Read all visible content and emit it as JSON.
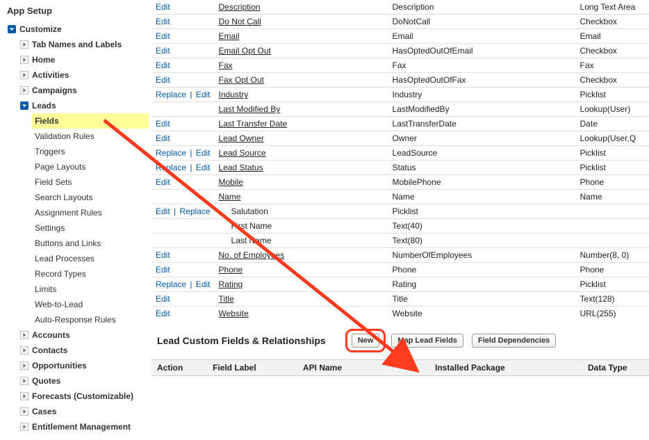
{
  "sidebar": {
    "title": "App Setup",
    "nodes": [
      {
        "label": "Customize",
        "expanded": true,
        "children": [
          {
            "label": "Tab Names and Labels",
            "expanded": false,
            "leaf": false
          },
          {
            "label": "Home",
            "expanded": false,
            "leaf": false
          },
          {
            "label": "Activities",
            "expanded": false,
            "leaf": false
          },
          {
            "label": "Campaigns",
            "expanded": false,
            "leaf": false
          },
          {
            "label": "Leads",
            "expanded": true,
            "children": [
              {
                "label": "Fields",
                "leaf": true,
                "highlighted": true
              },
              {
                "label": "Validation Rules",
                "leaf": true
              },
              {
                "label": "Triggers",
                "leaf": true
              },
              {
                "label": "Page Layouts",
                "leaf": true
              },
              {
                "label": "Field Sets",
                "leaf": true
              },
              {
                "label": "Search Layouts",
                "leaf": true
              },
              {
                "label": "Assignment Rules",
                "leaf": true
              },
              {
                "label": "Settings",
                "leaf": true
              },
              {
                "label": "Buttons and Links",
                "leaf": true
              },
              {
                "label": "Lead Processes",
                "leaf": true
              },
              {
                "label": "Record Types",
                "leaf": true
              },
              {
                "label": "Limits",
                "leaf": true
              },
              {
                "label": "Web-to-Lead",
                "leaf": true
              },
              {
                "label": "Auto-Response Rules",
                "leaf": true
              }
            ]
          },
          {
            "label": "Accounts",
            "expanded": false,
            "leaf": false
          },
          {
            "label": "Contacts",
            "expanded": false,
            "leaf": false
          },
          {
            "label": "Opportunities",
            "expanded": false,
            "leaf": false
          },
          {
            "label": "Quotes",
            "expanded": false,
            "leaf": false
          },
          {
            "label": "Forecasts (Customizable)",
            "expanded": false,
            "leaf": false
          },
          {
            "label": "Cases",
            "expanded": false,
            "leaf": false
          },
          {
            "label": "Entitlement Management",
            "expanded": false,
            "leaf": false
          }
        ]
      }
    ]
  },
  "fields": [
    {
      "actions": [
        "Edit"
      ],
      "label": "Description",
      "api": "Description",
      "type": "Long Text Area",
      "underline": true
    },
    {
      "actions": [
        "Edit"
      ],
      "label": "Do Not Call",
      "api": "DoNotCall",
      "type": "Checkbox",
      "underline": true
    },
    {
      "actions": [
        "Edit"
      ],
      "label": "Email",
      "api": "Email",
      "type": "Email",
      "underline": true
    },
    {
      "actions": [
        "Edit"
      ],
      "label": "Email Opt Out",
      "api": "HasOptedOutOfEmail",
      "type": "Checkbox",
      "underline": true
    },
    {
      "actions": [
        "Edit"
      ],
      "label": "Fax",
      "api": "Fax",
      "type": "Fax",
      "underline": true
    },
    {
      "actions": [
        "Edit"
      ],
      "label": "Fax Opt Out",
      "api": "HasOptedOutOfFax",
      "type": "Checkbox",
      "underline": true
    },
    {
      "actions": [
        "Replace",
        "Edit"
      ],
      "label": "Industry",
      "api": "Industry",
      "type": "Picklist",
      "underline": true
    },
    {
      "actions": [],
      "label": "Last Modified By",
      "api": "LastModifiedBy",
      "type": "Lookup(User)",
      "underline": true
    },
    {
      "actions": [
        "Edit"
      ],
      "label": "Last Transfer Date",
      "api": "LastTransferDate",
      "type": "Date",
      "underline": true
    },
    {
      "actions": [
        "Edit"
      ],
      "label": "Lead Owner",
      "api": "Owner",
      "type": "Lookup(User,Q",
      "underline": true
    },
    {
      "actions": [
        "Replace",
        "Edit"
      ],
      "label": "Lead Source",
      "api": "LeadSource",
      "type": "Picklist",
      "underline": true
    },
    {
      "actions": [
        "Replace",
        "Edit"
      ],
      "label": "Lead Status",
      "api": "Status",
      "type": "Picklist",
      "underline": true
    },
    {
      "actions": [
        "Edit"
      ],
      "label": "Mobile",
      "api": "MobilePhone",
      "type": "Phone",
      "underline": true
    },
    {
      "actions": [],
      "label": "Name",
      "api": "Name",
      "type": "Name",
      "underline": true
    },
    {
      "actions": [
        "Edit",
        "Replace"
      ],
      "label": "Salutation",
      "api": "Picklist",
      "type": "",
      "indent": true,
      "underline": false
    },
    {
      "actions": [],
      "label": "First Name",
      "api": "Text(40)",
      "type": "",
      "indent": true,
      "underline": false
    },
    {
      "actions": [],
      "label": "Last Name",
      "api": "Text(80)",
      "type": "",
      "indent": true,
      "underline": false
    },
    {
      "actions": [
        "Edit"
      ],
      "label": "No. of Employees",
      "api": "NumberOfEmployees",
      "type": "Number(8, 0)",
      "underline": true
    },
    {
      "actions": [
        "Edit"
      ],
      "label": "Phone",
      "api": "Phone",
      "type": "Phone",
      "underline": true
    },
    {
      "actions": [
        "Replace",
        "Edit"
      ],
      "label": "Rating",
      "api": "Rating",
      "type": "Picklist",
      "underline": true
    },
    {
      "actions": [
        "Edit"
      ],
      "label": "Title",
      "api": "Title",
      "type": "Text(128)",
      "underline": true
    },
    {
      "actions": [
        "Edit"
      ],
      "label": "Website",
      "api": "Website",
      "type": "URL(255)",
      "underline": true
    }
  ],
  "custom_section": {
    "title": "Lead Custom Fields & Relationships",
    "buttons": {
      "new": "New",
      "map": "Map Lead Fields",
      "deps": "Field Dependencies"
    },
    "columns": [
      "Action",
      "Field Label",
      "API Name",
      "Installed Package",
      "Data Type"
    ]
  }
}
